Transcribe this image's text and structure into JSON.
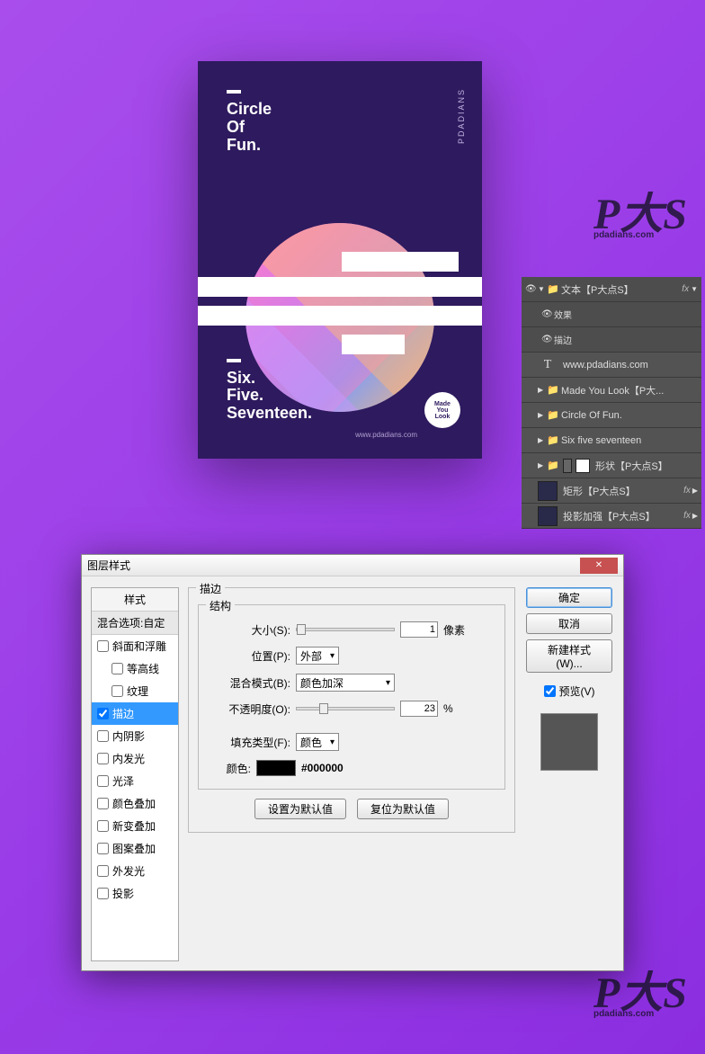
{
  "poster": {
    "top_line1": "Circle",
    "top_line2": "Of",
    "top_line3": "Fun.",
    "bottom_line1": "Six.",
    "bottom_line2": "Five.",
    "bottom_line3": "Seventeen.",
    "badge": "Made\nYou\nLook",
    "url": "www.pdadians.com",
    "side": "PDADIANS"
  },
  "watermark": {
    "main": "P大S",
    "sub": "pdadians.com"
  },
  "layers": {
    "group_text": "文本【P大点S】",
    "fx_label": "fx",
    "effects": "效果",
    "stroke_sub": "描边",
    "text_layer": "www.pdadians.com",
    "folder1": "Made You Look【P大...",
    "folder2": "Circle Of Fun.",
    "folder3": "Six five seventeen",
    "shape_group": "形状【P大点S】",
    "rect_layer": "矩形【P大点S】",
    "shadow_layer": "投影加强【P大点S】"
  },
  "dialog": {
    "title": "图层样式",
    "styles_header": "样式",
    "blend_options": "混合选项:自定",
    "items": {
      "bevel": "斜面和浮雕",
      "contour": "等高线",
      "texture": "纹理",
      "stroke": "描边",
      "inner_shadow": "内阴影",
      "inner_glow": "内发光",
      "satin": "光泽",
      "color_overlay": "颜色叠加",
      "gradient_overlay": "新变叠加",
      "pattern_overlay": "图案叠加",
      "outer_glow": "外发光",
      "drop_shadow": "投影"
    },
    "panel_title": "描边",
    "structure": "结构",
    "size_label": "大小(S):",
    "size_value": "1",
    "size_unit": "像素",
    "position_label": "位置(P):",
    "position_value": "外部",
    "blend_label": "混合模式(B):",
    "blend_value": "颜色加深",
    "opacity_label": "不透明度(O):",
    "opacity_value": "23",
    "opacity_unit": "%",
    "fill_type_label": "填充类型(F):",
    "fill_type_value": "颜色",
    "color_label": "颜色:",
    "color_hex": "#000000",
    "set_default": "设置为默认值",
    "reset_default": "复位为默认值",
    "ok": "确定",
    "cancel": "取消",
    "new_style": "新建样式(W)...",
    "preview": "预览(V)"
  }
}
